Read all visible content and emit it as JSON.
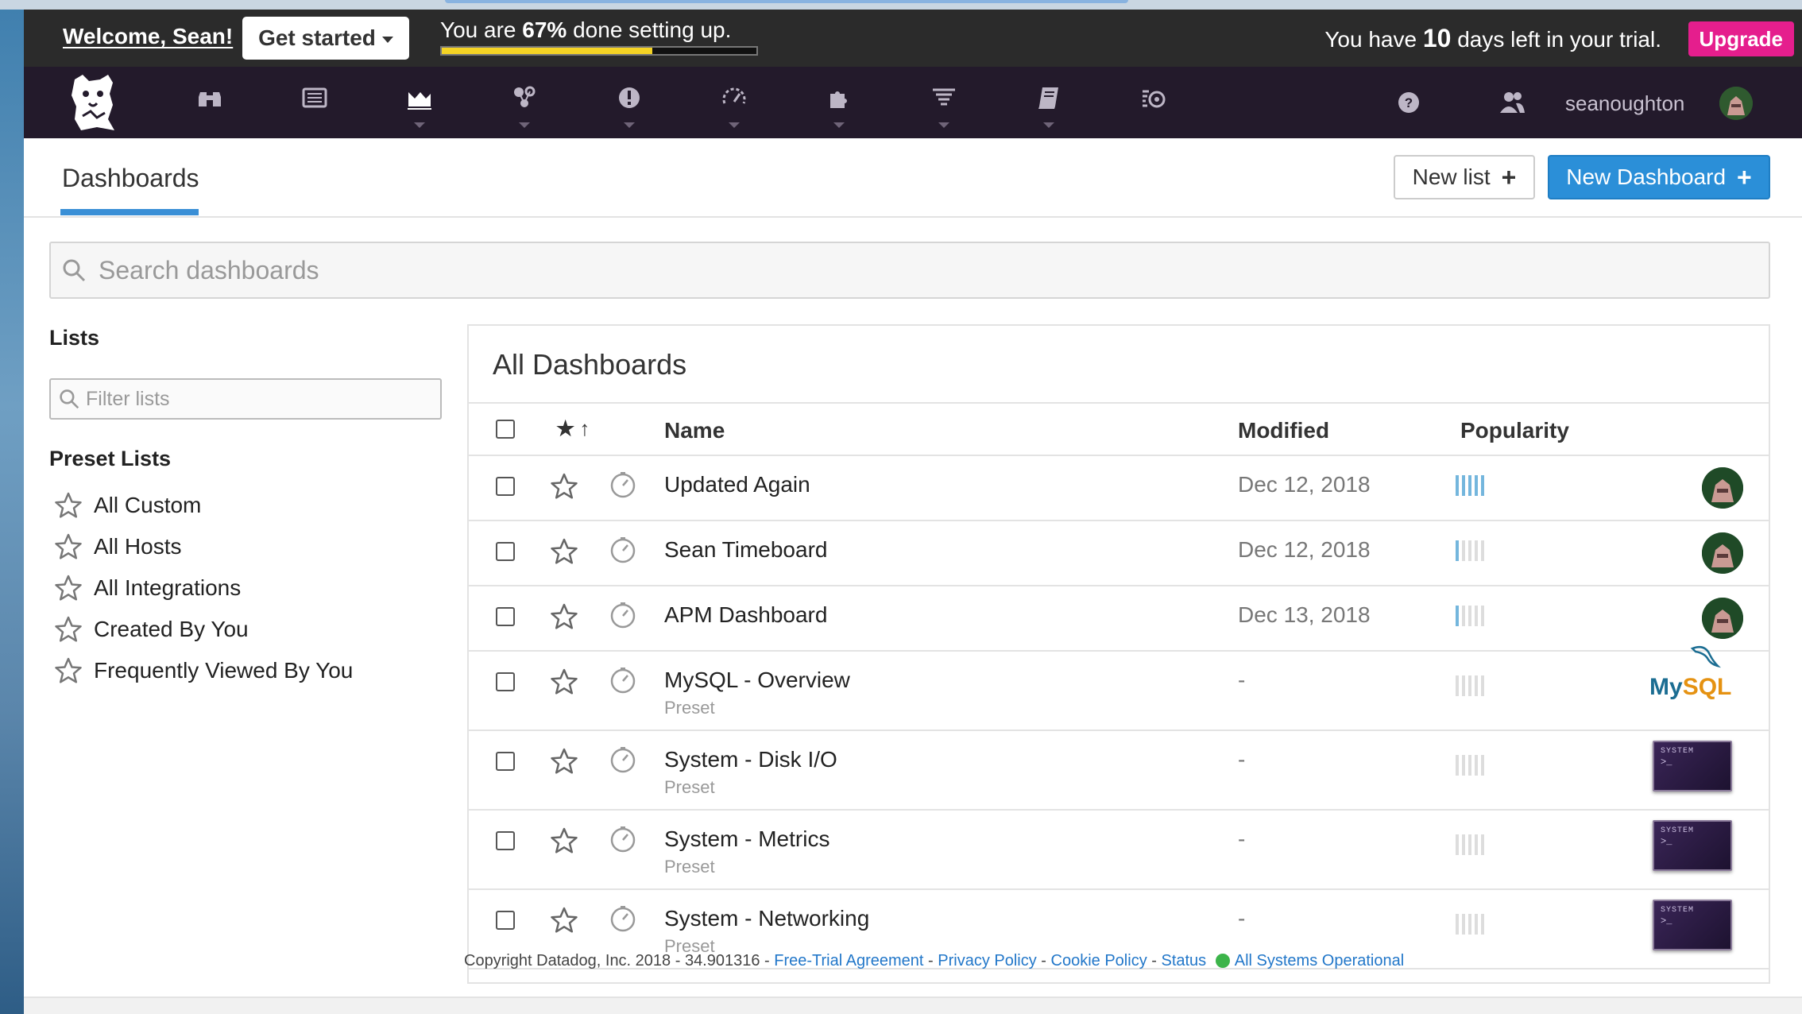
{
  "topbar": {
    "welcome": "Welcome, Sean!",
    "get_started": "Get started",
    "progress_prefix": "You are ",
    "progress_pct": "67%",
    "progress_suffix": " done setting up.",
    "progress_fraction": 0.67,
    "trial_prefix": "You have ",
    "trial_days": "10",
    "trial_suffix": " days left in your trial.",
    "upgrade": "Upgrade",
    "colors": {
      "progress": "#f4d324",
      "upgrade": "#e51e8d"
    }
  },
  "navbar": {
    "icons": [
      "datadog-logo",
      "binoculars-icon",
      "list-icon",
      "dashboards-icon",
      "infrastructure-icon",
      "monitors-icon",
      "apm-icon",
      "integrations-icon",
      "logs-icon",
      "notebooks-icon",
      "synthetics-icon",
      "help-icon",
      "team-icon"
    ],
    "username": "seanoughton"
  },
  "header": {
    "tab": "Dashboards",
    "new_list": "New list",
    "new_dashboard": "New Dashboard",
    "accent": "#2b8fd8"
  },
  "search": {
    "placeholder": "Search dashboards"
  },
  "sidebar": {
    "lists_title": "Lists",
    "filter_placeholder": "Filter lists",
    "preset_title": "Preset Lists",
    "preset_items": [
      "All Custom",
      "All Hosts",
      "All Integrations",
      "Created By You",
      "Frequently Viewed By You"
    ]
  },
  "panel": {
    "title": "All Dashboards",
    "columns": {
      "name": "Name",
      "modified": "Modified",
      "popularity": "Popularity"
    },
    "rows": [
      {
        "name": "Updated Again",
        "sub": "",
        "modified": "Dec 12, 2018",
        "popularity": 5,
        "icon": "user-avatar"
      },
      {
        "name": "Sean Timeboard",
        "sub": "",
        "modified": "Dec 12, 2018",
        "popularity": 1,
        "icon": "user-avatar"
      },
      {
        "name": "APM Dashboard",
        "sub": "",
        "modified": "Dec 13, 2018",
        "popularity": 1,
        "icon": "user-avatar"
      },
      {
        "name": "MySQL - Overview",
        "sub": "Preset",
        "modified": "-",
        "popularity": 0,
        "icon": "mysql-logo"
      },
      {
        "name": "System - Disk I/O",
        "sub": "Preset",
        "modified": "-",
        "popularity": 0,
        "icon": "system-thumbnail"
      },
      {
        "name": "System - Metrics",
        "sub": "Preset",
        "modified": "-",
        "popularity": 0,
        "icon": "system-thumbnail"
      },
      {
        "name": "System - Networking",
        "sub": "Preset",
        "modified": "-",
        "popularity": 0,
        "icon": "system-thumbnail"
      }
    ],
    "mysql_text_a": "My",
    "mysql_text_b": "SQL",
    "system_label": "SYSTEM",
    "system_prompt": ">_"
  },
  "footer": {
    "copyright": "Copyright Datadog, Inc. 2018 - 34.901316 -",
    "links": [
      "Free-Trial Agreement",
      "Privacy Policy",
      "Cookie Policy",
      "Status"
    ],
    "status": "All Systems Operational",
    "status_color": "#3cb44a"
  }
}
